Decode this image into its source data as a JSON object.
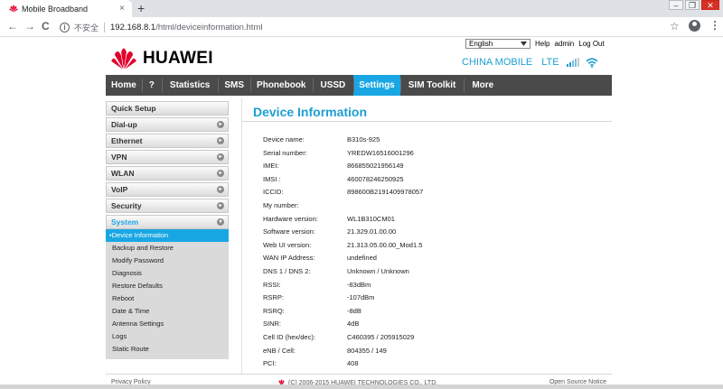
{
  "browser": {
    "tab_title": "Mobile Broadband",
    "tab_close": "×",
    "new_tab": "+",
    "win_min": "–",
    "win_max": "❐",
    "win_close": "✕",
    "back": "←",
    "forward": "→",
    "reload": "C",
    "info": "i",
    "security_label": "不安全",
    "url_host": "192.168.8.1",
    "url_path": "/html/deviceinformation.html",
    "bookmark": "☆",
    "menu": "⋮"
  },
  "header": {
    "language": "English",
    "help": "Help",
    "user": "admin",
    "logout": "Log Out",
    "brand": "HUAWEI",
    "operator": "CHINA MOBILE",
    "network": "LTE",
    "signal_bars": 4
  },
  "nav": {
    "items": [
      {
        "label": "Home"
      },
      {
        "label": "?"
      },
      {
        "label": "Statistics"
      },
      {
        "label": "SMS"
      },
      {
        "label": "Phonebook"
      },
      {
        "label": "USSD"
      },
      {
        "label": "Settings"
      },
      {
        "label": "SIM Toolkit"
      },
      {
        "label": "More"
      }
    ],
    "active": "Settings"
  },
  "sidebar": {
    "quick_setup": "Quick Setup",
    "groups": [
      {
        "label": "Dial-up"
      },
      {
        "label": "Ethernet"
      },
      {
        "label": "VPN"
      },
      {
        "label": "WLAN"
      },
      {
        "label": "VoIP"
      },
      {
        "label": "Security"
      },
      {
        "label": "System"
      }
    ],
    "system_items": [
      {
        "label": "Device Information"
      },
      {
        "label": "Backup and Restore"
      },
      {
        "label": "Modify Password"
      },
      {
        "label": "Diagnosis"
      },
      {
        "label": "Restore Defaults"
      },
      {
        "label": "Reboot"
      },
      {
        "label": "Date & Time"
      },
      {
        "label": "Antenna Settings"
      },
      {
        "label": "Logs"
      },
      {
        "label": "Static Route"
      }
    ],
    "active_item": "Device Information"
  },
  "page": {
    "title": "Device Information",
    "rows": [
      {
        "label": "Device name:",
        "value": "B310s-925"
      },
      {
        "label": "Serial number:",
        "value": "YREDW16516001296"
      },
      {
        "label": "IMEI:",
        "value": "866855021956149"
      },
      {
        "label": "IMSI :",
        "value": "460078246250925"
      },
      {
        "label": "ICCID:",
        "value": "898600B2191409978057"
      },
      {
        "label": "My number:",
        "value": ""
      },
      {
        "label": "Hardware version:",
        "value": "WL1B310CM01"
      },
      {
        "label": "Software version:",
        "value": "21.329.01.00.00"
      },
      {
        "label": "Web UI version:",
        "value": "21.313.05.00.00_Mod1.5"
      },
      {
        "label": "WAN IP Address:",
        "value": "undefined"
      },
      {
        "label": "DNS 1 / DNS 2:",
        "value": "Unknown / Unknown"
      },
      {
        "label": "RSSI:",
        "value": "-83dBm"
      },
      {
        "label": "RSRP:",
        "value": "-107dBm"
      },
      {
        "label": "RSRQ:",
        "value": "-8dB"
      },
      {
        "label": "SINR:",
        "value": "4dB"
      },
      {
        "label": "Cell ID (hex/dec):",
        "value": "C460395 / 205915029"
      },
      {
        "label": "eNB / Cell:",
        "value": "804355 / 149"
      },
      {
        "label": "PCI:",
        "value": "408"
      }
    ]
  },
  "footer": {
    "privacy": "Privacy Policy",
    "copyright": "(C) 2006-2015 HUAWEI TECHNOLOGIES CO., LTD.",
    "open_source": "Open Source Notice"
  },
  "colors": {
    "accent": "#19a7e3",
    "nav_bg": "#4a4a4a",
    "logo_red": "#e4002b"
  }
}
